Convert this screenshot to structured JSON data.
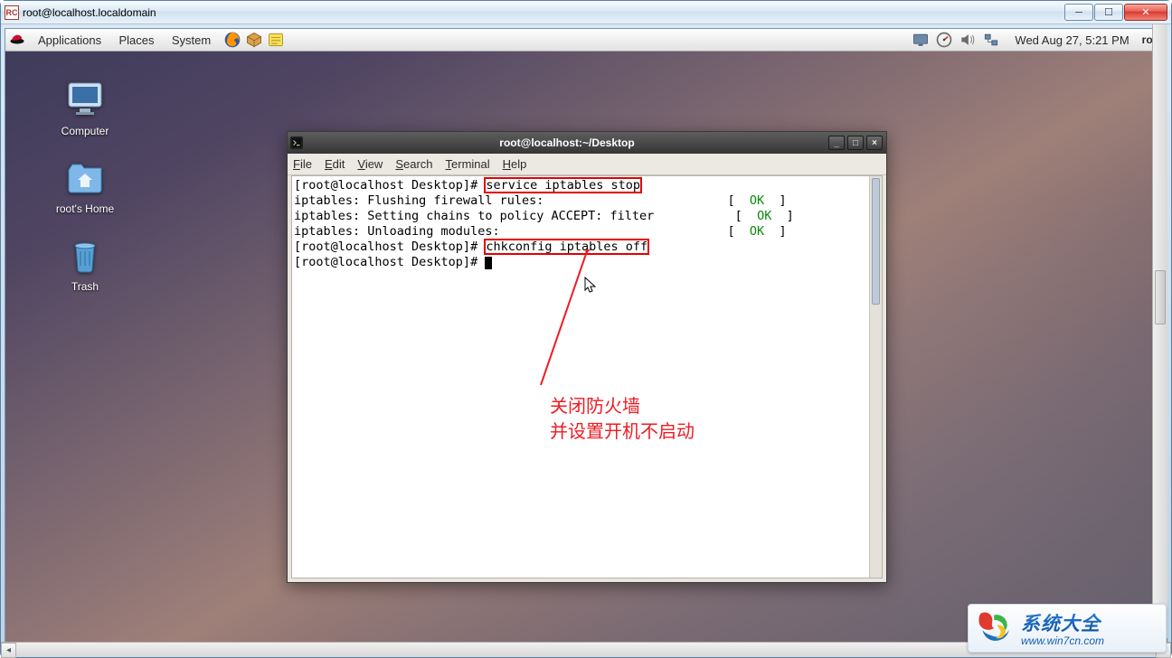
{
  "win7": {
    "title": "root@localhost.localdomain",
    "app_badge": "RC"
  },
  "gnome_panel": {
    "menus": [
      "Applications",
      "Places",
      "System"
    ],
    "clock": "Wed Aug 27,  5:21 PM",
    "user": "roo"
  },
  "desktop_icons": [
    {
      "name": "computer",
      "label": "Computer"
    },
    {
      "name": "home",
      "label": "root's Home"
    },
    {
      "name": "trash",
      "label": "Trash"
    }
  ],
  "terminal": {
    "title": "root@localhost:~/Desktop",
    "menus": [
      "File",
      "Edit",
      "View",
      "Search",
      "Terminal",
      "Help"
    ],
    "lines": {
      "p1_prompt": "[root@localhost Desktop]# ",
      "p1_cmd": "service iptables stop",
      "l1": "iptables: Flushing firewall rules:",
      "l2": "iptables: Setting chains to policy ACCEPT: filter",
      "l3": "iptables: Unloading modules:",
      "ok": "OK",
      "p2_prompt": "[root@localhost Desktop]# ",
      "p2_cmd": "chkconfig iptables off",
      "p3_prompt": "[root@localhost Desktop]# "
    }
  },
  "annotation": {
    "line1": "关闭防火墙",
    "line2": "并设置开机不启动"
  },
  "watermark": {
    "brand": "系统大全",
    "url": "www.win7cn.com"
  }
}
